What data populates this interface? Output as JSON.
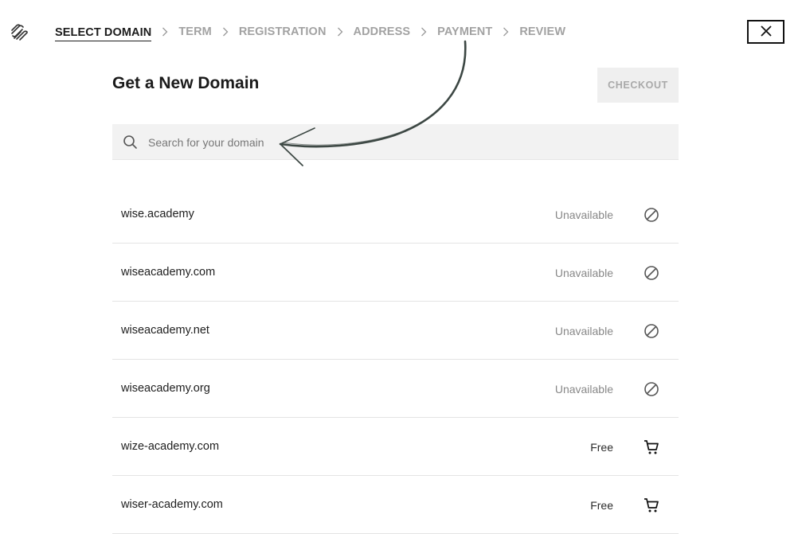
{
  "brand": {
    "logo_icon": "squarespace-logo-icon"
  },
  "breadcrumb": {
    "steps": [
      {
        "label": "SELECT DOMAIN",
        "active": true
      },
      {
        "label": "TERM",
        "active": false
      },
      {
        "label": "REGISTRATION",
        "active": false
      },
      {
        "label": "ADDRESS",
        "active": false
      },
      {
        "label": "PAYMENT",
        "active": false
      },
      {
        "label": "REVIEW",
        "active": false
      }
    ]
  },
  "close_icon": "close-icon",
  "header": {
    "title": "Get a New Domain",
    "checkout_label": "CHECKOUT"
  },
  "search": {
    "placeholder": "Search for your domain",
    "value": ""
  },
  "domains": [
    {
      "name": "wise.academy",
      "status": "Unavailable",
      "icon": "unavailable-icon"
    },
    {
      "name": "wiseacademy.com",
      "status": "Unavailable",
      "icon": "unavailable-icon"
    },
    {
      "name": "wiseacademy.net",
      "status": "Unavailable",
      "icon": "unavailable-icon"
    },
    {
      "name": "wiseacademy.org",
      "status": "Unavailable",
      "icon": "unavailable-icon"
    },
    {
      "name": "wize-academy.com",
      "status": "Free",
      "icon": "cart-icon"
    },
    {
      "name": "wiser-academy.com",
      "status": "Free",
      "icon": "cart-icon"
    }
  ],
  "colors": {
    "accent": "#1c1c1c",
    "muted": "#a2a2a2",
    "field_bg": "#f2f2f2",
    "annotation": "#3d4844"
  }
}
